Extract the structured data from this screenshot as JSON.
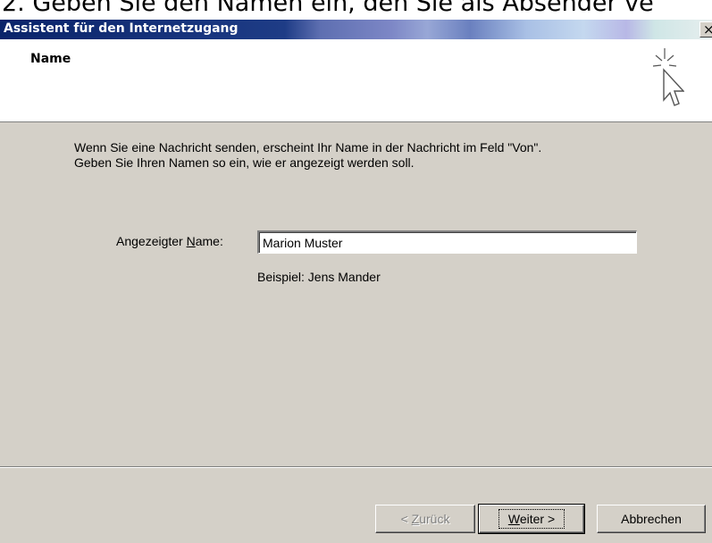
{
  "caption": "2. Geben Sie den Namen ein, den Sie als Absender ve",
  "window": {
    "title": "Assistent für den Internetzugang",
    "close_label": "×"
  },
  "header": {
    "title": "Name"
  },
  "body": {
    "intro_line1": "Wenn Sie eine Nachricht senden, erscheint Ihr Name in der Nachricht im Feld \"Von\".",
    "intro_line2": "Geben Sie Ihren Namen so ein, wie er angezeigt werden soll.",
    "name_label_before": "Angezeigter ",
    "name_label_mnemonic": "N",
    "name_label_after": "ame:",
    "name_value": "Marion Muster",
    "example": "Beispiel: Jens Mander"
  },
  "buttons": {
    "back_prefix": "< ",
    "back_mnemonic": "Z",
    "back_rest": "urück",
    "next_mnemonic": "W",
    "next_rest": "eiter >",
    "cancel": "Abbrechen"
  },
  "icons": {
    "wizard": "sparkle-cursor-icon",
    "close": "close-icon"
  },
  "colors": {
    "titlebar_start": "#0a246a",
    "dialog_face": "#d4d0c8",
    "header_bg": "#ffffff"
  }
}
